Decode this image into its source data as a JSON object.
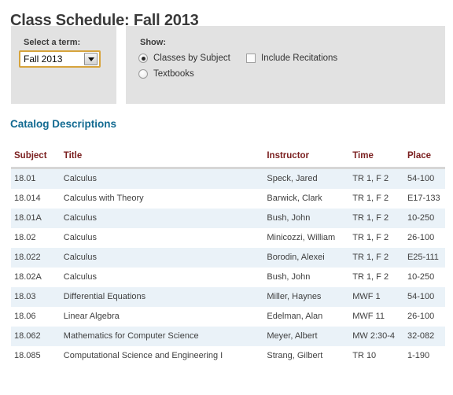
{
  "page": {
    "title": "Class Schedule: Fall 2013"
  },
  "term_panel": {
    "label": "Select a term:",
    "select": {
      "name": "term-select",
      "value": "Fall 2013",
      "options": [
        "Fall 2013"
      ],
      "arrow_icon": "chevron-down-icon",
      "focus_border_color": "#d7a43c"
    }
  },
  "show_panel": {
    "label": "Show:",
    "radios": [
      {
        "label": "Classes by Subject",
        "checked": true
      },
      {
        "label": "Textbooks",
        "checked": false
      }
    ],
    "checkboxes": [
      {
        "label": "Include Recitations",
        "checked": false
      }
    ]
  },
  "catalog": {
    "heading": "Catalog Descriptions",
    "heading_color": "#126a91",
    "header_color": "#7b2020",
    "alt_row_color": "#eaf2f8",
    "columns": [
      "Subject",
      "Title",
      "Instructor",
      "Time",
      "Place"
    ],
    "rows": [
      {
        "subject": "18.01",
        "title": "Calculus",
        "instructor": "Speck, Jared",
        "time": "TR 1, F 2",
        "place": "54-100"
      },
      {
        "subject": "18.014",
        "title": "Calculus with Theory",
        "instructor": "Barwick, Clark",
        "time": "TR 1, F 2",
        "place": "E17-133"
      },
      {
        "subject": "18.01A",
        "title": "Calculus",
        "instructor": "Bush, John",
        "time": "TR 1, F 2",
        "place": "10-250"
      },
      {
        "subject": "18.02",
        "title": "Calculus",
        "instructor": "Minicozzi, William",
        "time": "TR 1, F 2",
        "place": "26-100"
      },
      {
        "subject": "18.022",
        "title": "Calculus",
        "instructor": "Borodin, Alexei",
        "time": "TR 1, F 2",
        "place": "E25-111"
      },
      {
        "subject": "18.02A",
        "title": "Calculus",
        "instructor": "Bush, John",
        "time": "TR 1, F 2",
        "place": "10-250"
      },
      {
        "subject": "18.03",
        "title": "Differential Equations",
        "instructor": "Miller, Haynes",
        "time": "MWF 1",
        "place": "54-100"
      },
      {
        "subject": "18.06",
        "title": "Linear Algebra",
        "instructor": "Edelman, Alan",
        "time": "MWF 11",
        "place": "26-100"
      },
      {
        "subject": "18.062",
        "title": "Mathematics for Computer Science",
        "instructor": "Meyer, Albert",
        "time": "MW 2:30-4",
        "place": "32-082"
      },
      {
        "subject": "18.085",
        "title": "Computational Science and Engineering I",
        "instructor": "Strang, Gilbert",
        "time": "TR 10",
        "place": "1-190"
      }
    ]
  }
}
